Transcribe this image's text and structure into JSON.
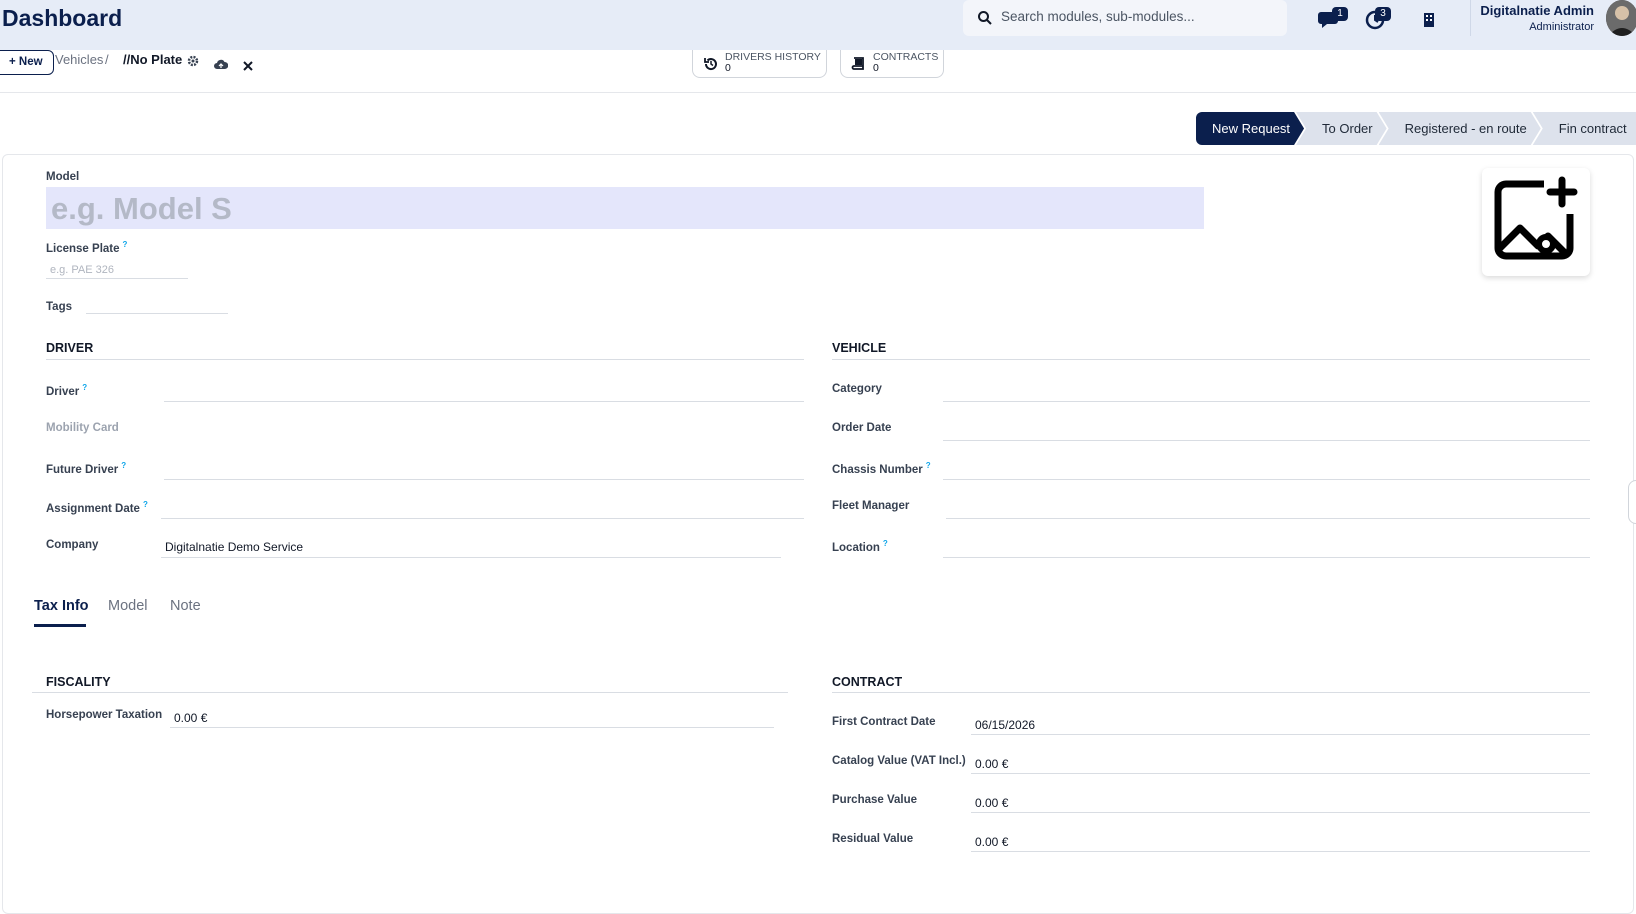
{
  "navbar": {
    "brand": "Dashboard",
    "search_placeholder": "Search modules, sub-modules...",
    "messages_count": "1",
    "activities_count": "3",
    "user_name": "Digitalnatie Admin",
    "user_role": "Administrator"
  },
  "control": {
    "new_label": "New",
    "breadcrumb_parent": "Vehicles",
    "breadcrumb_sep": "/",
    "breadcrumb_current": "//No Plate",
    "drivers_history_label": "DRIVERS HISTORY",
    "drivers_history_value": "0",
    "contracts_label": "CONTRACTS",
    "contracts_value": "0"
  },
  "statusbar": {
    "stages": [
      "New Request",
      "To Order",
      "Registered - en route",
      "Fin contract"
    ],
    "active": "New Request"
  },
  "form": {
    "model_label": "Model",
    "model_placeholder": "e.g. Model S",
    "plate_label": "License Plate",
    "plate_help": "?",
    "plate_placeholder": "e.g. PAE 326",
    "tags_label": "Tags"
  },
  "driver": {
    "title": "DRIVER",
    "driver_label": "Driver",
    "mobility_label": "Mobility Card",
    "future_driver_label": "Future Driver",
    "assignment_date_label": "Assignment Date",
    "company_label": "Company",
    "company_value": "Digitalnatie Demo Service"
  },
  "vehicle": {
    "title": "VEHICLE",
    "category_label": "Category",
    "order_date_label": "Order Date",
    "chassis_label": "Chassis Number",
    "fleet_manager_label": "Fleet Manager",
    "location_label": "Location"
  },
  "tabs": [
    "Tax Info",
    "Model",
    "Note"
  ],
  "fiscality": {
    "title": "FISCALITY",
    "horsepower_label": "Horsepower Taxation",
    "horsepower_value": "0.00 €"
  },
  "contract": {
    "title": "CONTRACT",
    "first_date_label": "First Contract Date",
    "first_date_value": "06/15/2026",
    "catalog_label": "Catalog Value (VAT Incl.)",
    "catalog_value": "0.00 €",
    "purchase_label": "Purchase Value",
    "purchase_value": "0.00 €",
    "residual_label": "Residual Value",
    "residual_value": "0.00 €"
  },
  "colors": {
    "primary": "#0b1f4d",
    "navbar_bg": "#e6ecf7",
    "stage_bg": "#dde2ec",
    "model_input_bg": "#e4e6fb",
    "help_color": "#0ea5e9"
  }
}
